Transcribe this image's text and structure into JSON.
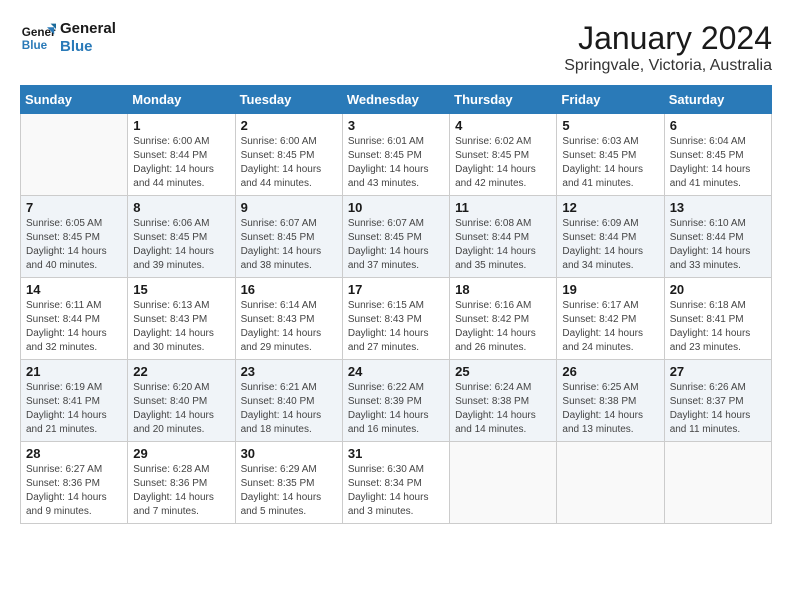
{
  "logo": {
    "line1": "General",
    "line2": "Blue"
  },
  "title": "January 2024",
  "location": "Springvale, Victoria, Australia",
  "weekdays": [
    "Sunday",
    "Monday",
    "Tuesday",
    "Wednesday",
    "Thursday",
    "Friday",
    "Saturday"
  ],
  "weeks": [
    [
      {
        "day": "",
        "info": ""
      },
      {
        "day": "1",
        "info": "Sunrise: 6:00 AM\nSunset: 8:44 PM\nDaylight: 14 hours\nand 44 minutes."
      },
      {
        "day": "2",
        "info": "Sunrise: 6:00 AM\nSunset: 8:45 PM\nDaylight: 14 hours\nand 44 minutes."
      },
      {
        "day": "3",
        "info": "Sunrise: 6:01 AM\nSunset: 8:45 PM\nDaylight: 14 hours\nand 43 minutes."
      },
      {
        "day": "4",
        "info": "Sunrise: 6:02 AM\nSunset: 8:45 PM\nDaylight: 14 hours\nand 42 minutes."
      },
      {
        "day": "5",
        "info": "Sunrise: 6:03 AM\nSunset: 8:45 PM\nDaylight: 14 hours\nand 41 minutes."
      },
      {
        "day": "6",
        "info": "Sunrise: 6:04 AM\nSunset: 8:45 PM\nDaylight: 14 hours\nand 41 minutes."
      }
    ],
    [
      {
        "day": "7",
        "info": "Sunrise: 6:05 AM\nSunset: 8:45 PM\nDaylight: 14 hours\nand 40 minutes."
      },
      {
        "day": "8",
        "info": "Sunrise: 6:06 AM\nSunset: 8:45 PM\nDaylight: 14 hours\nand 39 minutes."
      },
      {
        "day": "9",
        "info": "Sunrise: 6:07 AM\nSunset: 8:45 PM\nDaylight: 14 hours\nand 38 minutes."
      },
      {
        "day": "10",
        "info": "Sunrise: 6:07 AM\nSunset: 8:45 PM\nDaylight: 14 hours\nand 37 minutes."
      },
      {
        "day": "11",
        "info": "Sunrise: 6:08 AM\nSunset: 8:44 PM\nDaylight: 14 hours\nand 35 minutes."
      },
      {
        "day": "12",
        "info": "Sunrise: 6:09 AM\nSunset: 8:44 PM\nDaylight: 14 hours\nand 34 minutes."
      },
      {
        "day": "13",
        "info": "Sunrise: 6:10 AM\nSunset: 8:44 PM\nDaylight: 14 hours\nand 33 minutes."
      }
    ],
    [
      {
        "day": "14",
        "info": "Sunrise: 6:11 AM\nSunset: 8:44 PM\nDaylight: 14 hours\nand 32 minutes."
      },
      {
        "day": "15",
        "info": "Sunrise: 6:13 AM\nSunset: 8:43 PM\nDaylight: 14 hours\nand 30 minutes."
      },
      {
        "day": "16",
        "info": "Sunrise: 6:14 AM\nSunset: 8:43 PM\nDaylight: 14 hours\nand 29 minutes."
      },
      {
        "day": "17",
        "info": "Sunrise: 6:15 AM\nSunset: 8:43 PM\nDaylight: 14 hours\nand 27 minutes."
      },
      {
        "day": "18",
        "info": "Sunrise: 6:16 AM\nSunset: 8:42 PM\nDaylight: 14 hours\nand 26 minutes."
      },
      {
        "day": "19",
        "info": "Sunrise: 6:17 AM\nSunset: 8:42 PM\nDaylight: 14 hours\nand 24 minutes."
      },
      {
        "day": "20",
        "info": "Sunrise: 6:18 AM\nSunset: 8:41 PM\nDaylight: 14 hours\nand 23 minutes."
      }
    ],
    [
      {
        "day": "21",
        "info": "Sunrise: 6:19 AM\nSunset: 8:41 PM\nDaylight: 14 hours\nand 21 minutes."
      },
      {
        "day": "22",
        "info": "Sunrise: 6:20 AM\nSunset: 8:40 PM\nDaylight: 14 hours\nand 20 minutes."
      },
      {
        "day": "23",
        "info": "Sunrise: 6:21 AM\nSunset: 8:40 PM\nDaylight: 14 hours\nand 18 minutes."
      },
      {
        "day": "24",
        "info": "Sunrise: 6:22 AM\nSunset: 8:39 PM\nDaylight: 14 hours\nand 16 minutes."
      },
      {
        "day": "25",
        "info": "Sunrise: 6:24 AM\nSunset: 8:38 PM\nDaylight: 14 hours\nand 14 minutes."
      },
      {
        "day": "26",
        "info": "Sunrise: 6:25 AM\nSunset: 8:38 PM\nDaylight: 14 hours\nand 13 minutes."
      },
      {
        "day": "27",
        "info": "Sunrise: 6:26 AM\nSunset: 8:37 PM\nDaylight: 14 hours\nand 11 minutes."
      }
    ],
    [
      {
        "day": "28",
        "info": "Sunrise: 6:27 AM\nSunset: 8:36 PM\nDaylight: 14 hours\nand 9 minutes."
      },
      {
        "day": "29",
        "info": "Sunrise: 6:28 AM\nSunset: 8:36 PM\nDaylight: 14 hours\nand 7 minutes."
      },
      {
        "day": "30",
        "info": "Sunrise: 6:29 AM\nSunset: 8:35 PM\nDaylight: 14 hours\nand 5 minutes."
      },
      {
        "day": "31",
        "info": "Sunrise: 6:30 AM\nSunset: 8:34 PM\nDaylight: 14 hours\nand 3 minutes."
      },
      {
        "day": "",
        "info": ""
      },
      {
        "day": "",
        "info": ""
      },
      {
        "day": "",
        "info": ""
      }
    ]
  ]
}
